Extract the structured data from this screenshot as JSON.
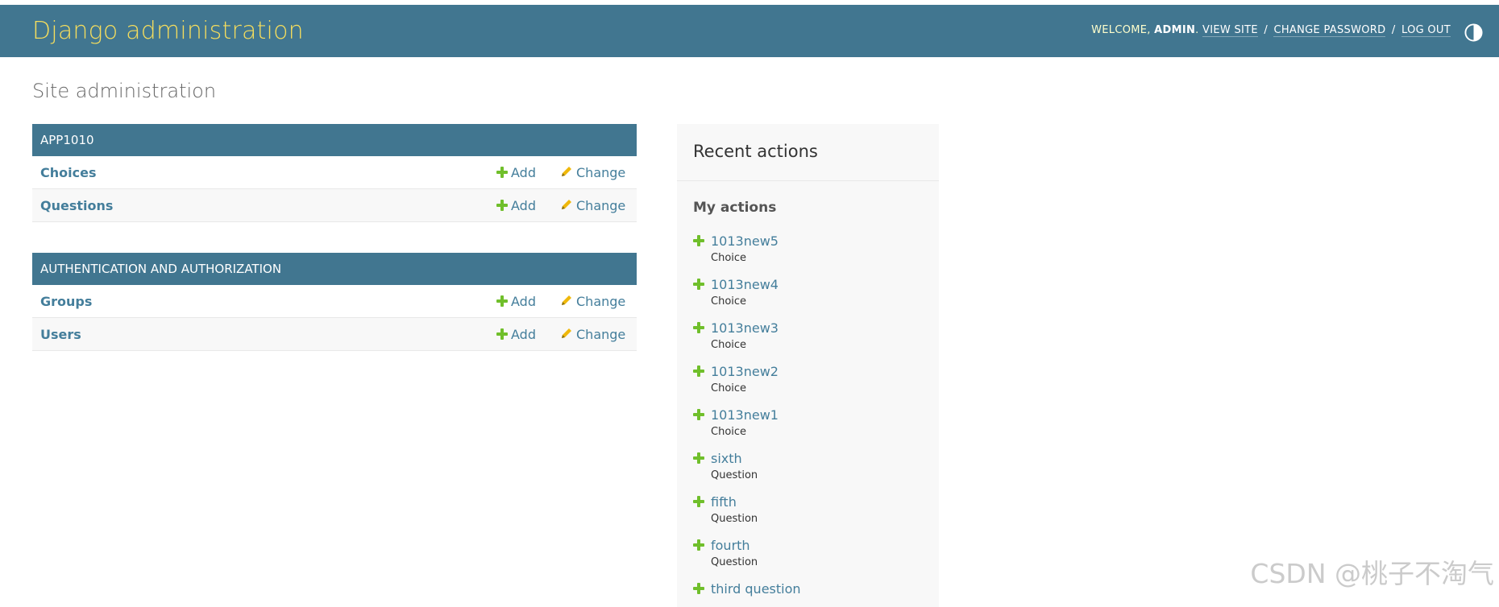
{
  "header": {
    "brand": "Django administration",
    "welcome_text": "Welcome,",
    "username": "admin",
    "view_site": "View site",
    "change_password": "Change password",
    "log_out": "Log out",
    "separator": "/",
    "theme_toggle_icon": "contrast-icon"
  },
  "page": {
    "title": "Site administration"
  },
  "modules": [
    {
      "caption": "APP1010",
      "models": [
        {
          "name": "Choices",
          "add": "Add",
          "change": "Change"
        },
        {
          "name": "Questions",
          "add": "Add",
          "change": "Change"
        }
      ]
    },
    {
      "caption": "Authentication and Authorization",
      "models": [
        {
          "name": "Groups",
          "add": "Add",
          "change": "Change"
        },
        {
          "name": "Users",
          "add": "Add",
          "change": "Change"
        }
      ]
    }
  ],
  "recent_actions": {
    "title": "Recent actions",
    "subtitle": "My actions",
    "items": [
      {
        "name": "1013new5",
        "type": "Choice"
      },
      {
        "name": "1013new4",
        "type": "Choice"
      },
      {
        "name": "1013new3",
        "type": "Choice"
      },
      {
        "name": "1013new2",
        "type": "Choice"
      },
      {
        "name": "1013new1",
        "type": "Choice"
      },
      {
        "name": "sixth",
        "type": "Question"
      },
      {
        "name": "fifth",
        "type": "Question"
      },
      {
        "name": "fourth",
        "type": "Question"
      },
      {
        "name": "third question",
        "type": ""
      }
    ]
  },
  "watermark": "CSDN @桃子不淘气",
  "colors": {
    "header_bg": "#417690",
    "brand": "#f5dd5d",
    "link": "#447e9b",
    "add_icon": "#70bf2b",
    "change_icon": "#efb80b"
  }
}
